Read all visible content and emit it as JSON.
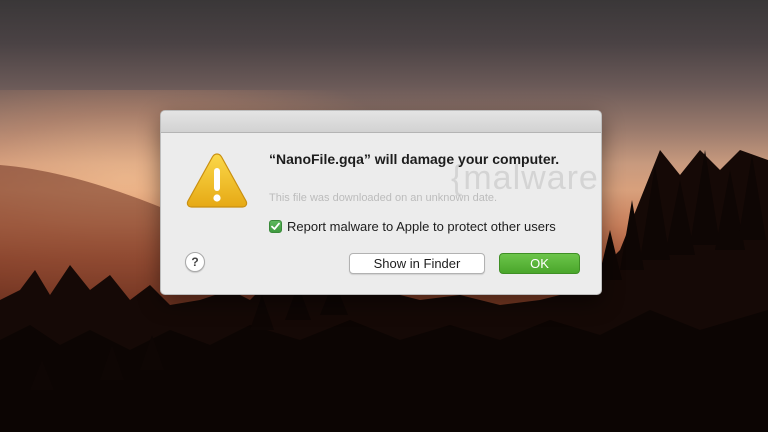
{
  "background": {
    "description_colors": [
      "#3a3738",
      "#d8a07c",
      "#2a1208"
    ]
  },
  "dialog": {
    "title": "“NanoFile.gqa” will damage your computer.",
    "subtitle": "This file was downloaded on an unknown date.",
    "watermark": "{malware",
    "checkbox": {
      "label": "Report malware to Apple to protect other users",
      "checked": true
    },
    "help_label": "?",
    "buttons": {
      "show_in_finder": "Show in Finder",
      "ok": "OK"
    },
    "colors": {
      "ok_button": "#4aa62b",
      "warning_icon": "#f2c230",
      "checkbox": "#3f9a3f"
    },
    "icon": "warning-triangle-icon"
  }
}
